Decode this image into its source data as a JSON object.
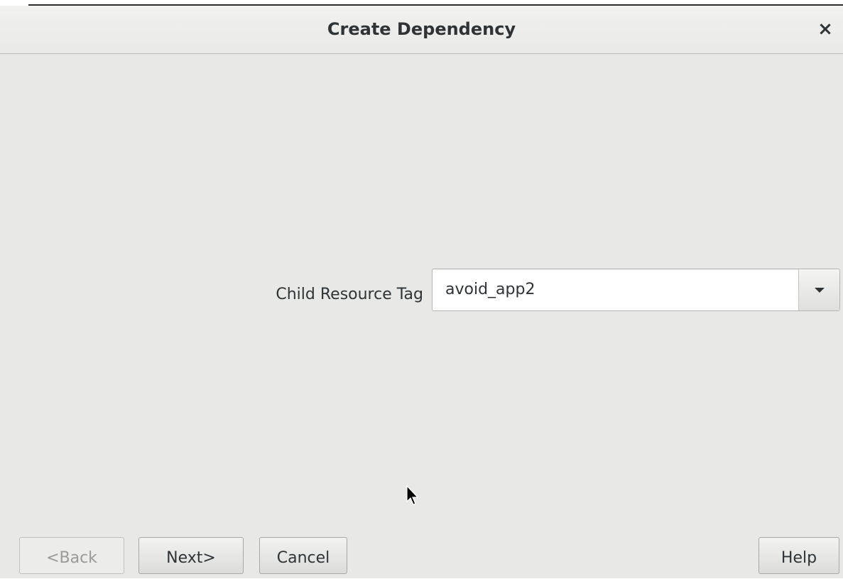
{
  "dialog": {
    "title": "Create Dependency",
    "close_symbol": "×"
  },
  "form": {
    "child_resource_tag_label": "Child Resource Tag",
    "child_resource_tag_value": "avoid_app2"
  },
  "buttons": {
    "back": "<Back",
    "next": "Next>",
    "cancel": "Cancel",
    "help": "Help"
  }
}
